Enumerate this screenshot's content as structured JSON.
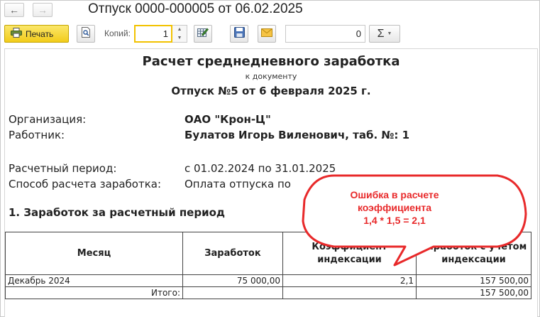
{
  "window": {
    "title": "Отпуск 0000-000005 от 06.02.2025"
  },
  "toolbar": {
    "print_label": "Печать",
    "copies_label": "Копий:",
    "copies_value": "1",
    "sum_value": "0",
    "sum_symbol": "Σ"
  },
  "report": {
    "title": "Расчет среднедневного заработка",
    "subtitle": "к документу",
    "document": "Отпуск №5 от 6 февраля 2025 г.",
    "org_label": "Организация:",
    "org_value": "ОАО \"Крон-Ц\"",
    "employee_label": "Работник:",
    "employee_value": "Булатов Игорь Виленович, таб. №: 1",
    "period_label": "Расчетный период:",
    "period_value": "с 01.02.2024 по 31.01.2025",
    "method_label": "Способ расчета заработка:",
    "method_value": "Оплата отпуска по",
    "section_title": "1. Заработок за расчетный период",
    "table": {
      "headers": [
        "Месяц",
        "Заработок",
        "Коэффициент индексации",
        "Заработок с учетом индексации"
      ],
      "rows": [
        [
          "Декабрь 2024",
          "75 000,00",
          "2,1",
          "157 500,00"
        ],
        [
          "Итого:",
          "",
          "",
          "157 500,00"
        ]
      ]
    }
  },
  "callout": {
    "line1": "Ошибка в расчете",
    "line2": "коэффициента",
    "line3": "1,4 * 1,5 = 2,1",
    "color": "#e8292a"
  }
}
